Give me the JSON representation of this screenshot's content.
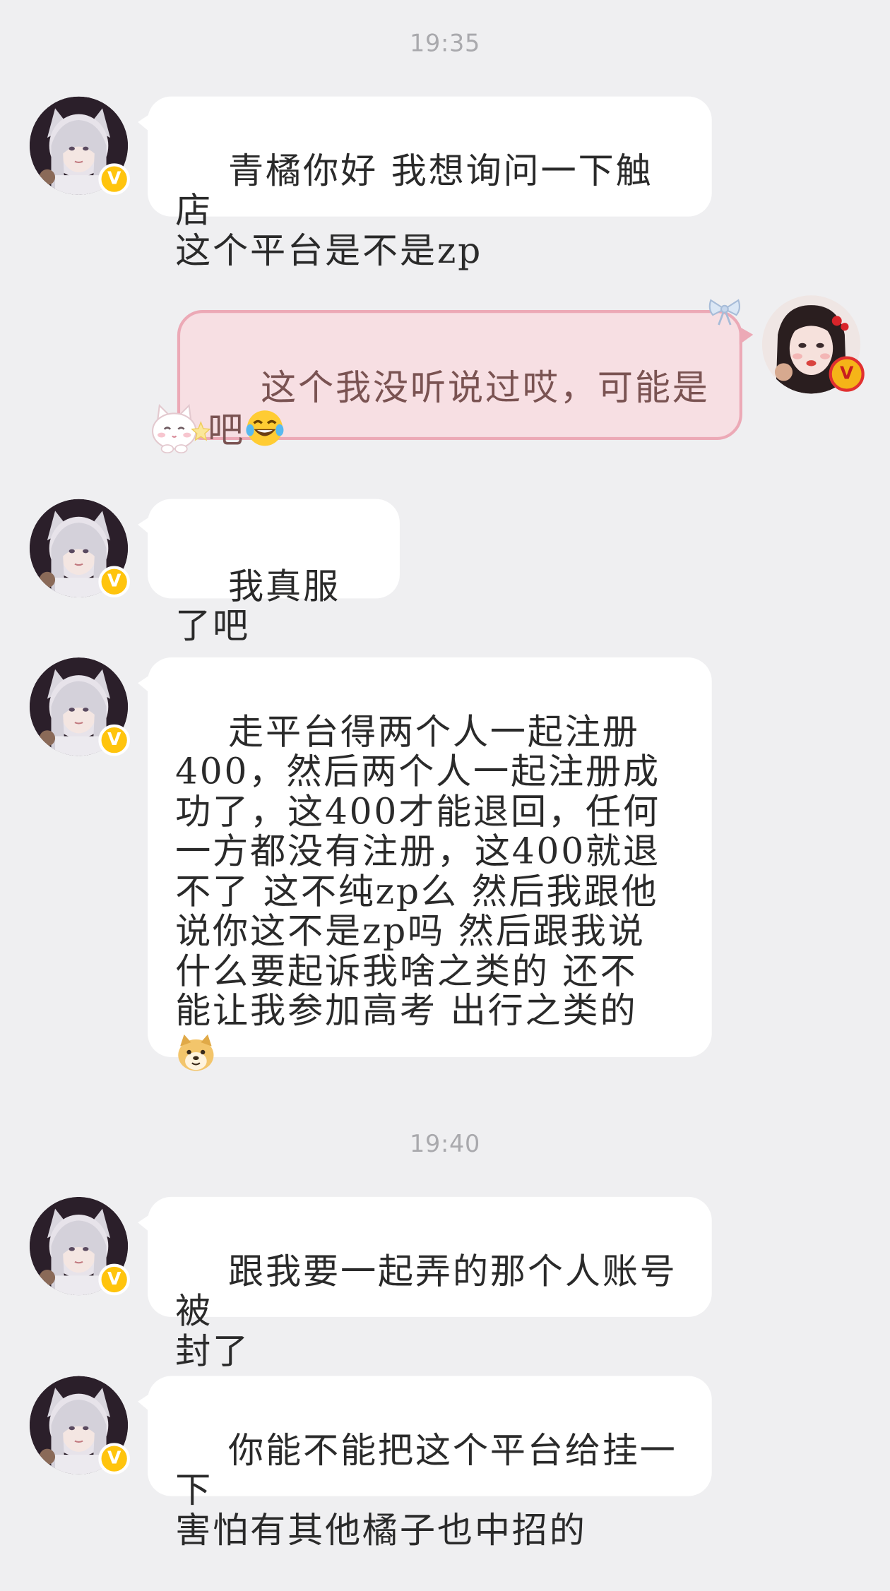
{
  "timestamps": [
    "19:35",
    "19:40"
  ],
  "verified_badge": "V",
  "other_avatar": {
    "icon": "avatar-silver-hair-cat-ears"
  },
  "my_avatar": {
    "icon": "avatar-black-hair-red-bow"
  },
  "messages": [
    {
      "sender": "other",
      "text": "青橘你好 我想询问一下触店\n这个平台是不是zp"
    },
    {
      "sender": "me",
      "text": "这个我没听说过哎，可能是\n吧",
      "emoji": "tears-of-joy"
    },
    {
      "sender": "other",
      "text": "我真服了吧"
    },
    {
      "sender": "other",
      "text": "走平台得两个人一起注册\n400，然后两个人一起注册成\n功了，这400才能退回，任何\n一方都没有注册，这400就退\n不了 这不纯zp么 然后我跟他\n说你这不是zp吗 然后跟我说\n什么要起诉我啥之类的 还不\n能让我参加高考 出行之类的\n",
      "emoji": "doge"
    },
    {
      "sender": "other",
      "text": "跟我要一起弄的那个人账号被\n封了"
    },
    {
      "sender": "other",
      "text": "你能不能把这个平台给挂一下\n害怕有其他橘子也中招的"
    }
  ],
  "colors": {
    "background": "#efeff1",
    "other_bubble": "#ffffff",
    "my_bubble": "#f7dfe3",
    "my_bubble_border": "#eca9b6",
    "my_text": "#7a5352",
    "badge": "#ffc40d"
  },
  "decorations": [
    "bow-icon",
    "white-cat-icon",
    "star-icon"
  ]
}
